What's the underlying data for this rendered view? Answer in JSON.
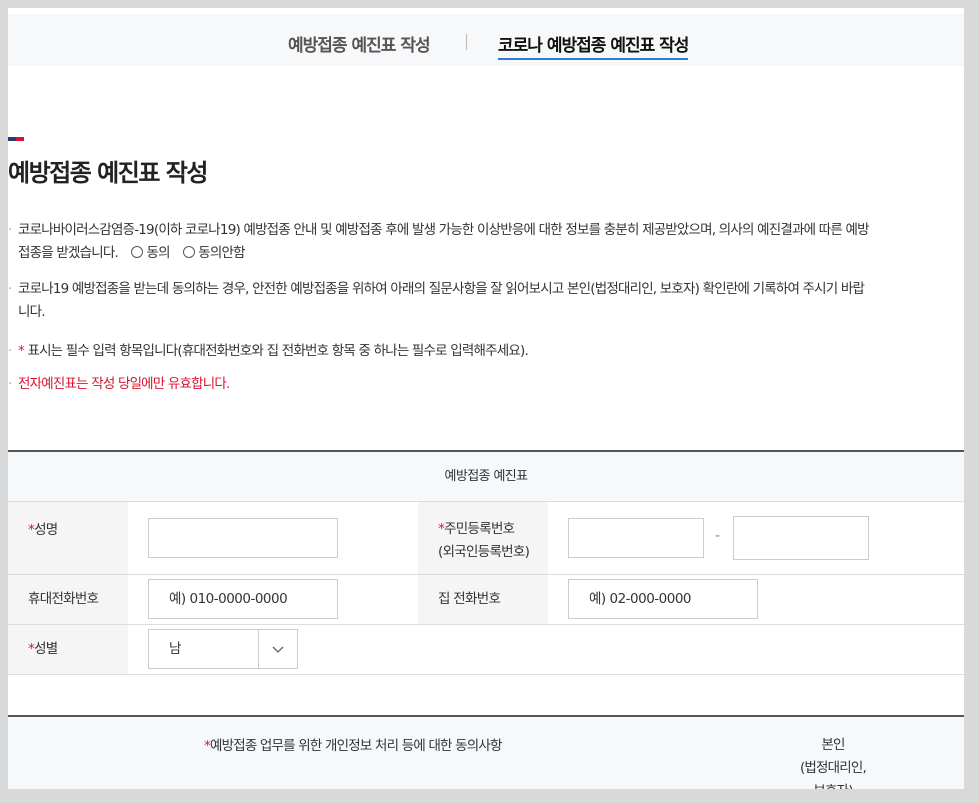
{
  "tabs": [
    {
      "label": "예방접종 예진표 작성"
    },
    {
      "label": "코로나 예방접종 예진표 작성"
    }
  ],
  "page_title": "예방접종 예진표 작성",
  "notes": {
    "n1_line1": "코로나바이러스감염증-19(이하 코로나19) 예방접종 안내 및 예방접종 후에 발생 가능한 이상반응에 대한 정보를 충분히 제공받았으며, 의사의 예진결과에 따른 예방",
    "n1_line2": "접종을 받겠습니다.",
    "agree": "동의",
    "disagree": "동의안함",
    "n2_line1": "코로나19 예방접종을 받는데 동의하는 경우, 안전한 예방접종을 위하여 아래의 질문사항을 잘 읽어보시고 본인(법정대리인, 보호자) 확인란에 기록하여 주시기 바랍",
    "n2_line2": "니다.",
    "n3_mark": "*",
    "n3_text": " 표시는 필수 입력 항목입니다(휴대전화번호와 집 전화번호 항목 중 하나는 필수로 입력해주세요).",
    "n4": "전자예진표는 작성 당일에만 유효합니다."
  },
  "form": {
    "header": "예방접종 예진표",
    "name_label": "성명",
    "rrn_label_1": "주민등록번호",
    "rrn_label_2": "(외국인등록번호)",
    "rrn_dash": "-",
    "mobile_label": "휴대전화번호",
    "mobile_placeholder": "예) 010-0000-0000",
    "home_label": "집 전화번호",
    "home_placeholder": "예) 02-000-0000",
    "gender_label": "성별",
    "gender_value": "남",
    "required_mark": "*"
  },
  "consent": {
    "text": "예방접종 업무를 위한 개인정보 처리 등에 대한 동의사항",
    "right_1": "본인",
    "right_2": "(법정대리인,",
    "right_3": "보호자)"
  }
}
